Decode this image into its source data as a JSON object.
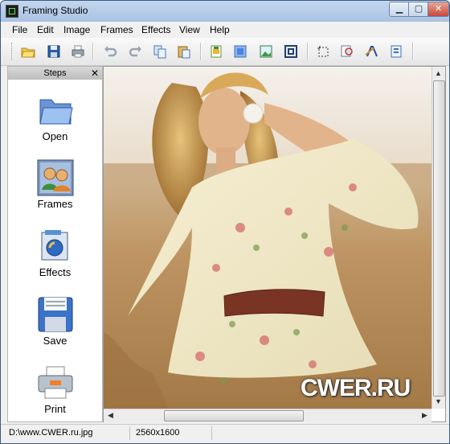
{
  "window": {
    "title": "Framing Studio"
  },
  "menu": [
    "File",
    "Edit",
    "Image",
    "Frames",
    "Effects",
    "View",
    "Help"
  ],
  "toolbar": {
    "buttons": [
      "open-icon",
      "save-icon",
      "print-icon",
      "undo-icon",
      "redo-icon",
      "copy-icon",
      "paste-icon",
      "crop-icon",
      "frame-icon",
      "image-icon",
      "border-icon",
      "select-icon",
      "zoom-icon",
      "text-icon",
      "info-icon"
    ]
  },
  "steps": {
    "title": "Steps",
    "close": "✕",
    "items": [
      {
        "label": "Open",
        "icon": "folder-icon"
      },
      {
        "label": "Frames",
        "icon": "frames-icon"
      },
      {
        "label": "Effects",
        "icon": "effects-icon"
      },
      {
        "label": "Save",
        "icon": "floppy-icon"
      },
      {
        "label": "Print",
        "icon": "printer-icon"
      }
    ]
  },
  "viewer": {
    "watermark": "CWER.RU"
  },
  "status": {
    "path": "D:\\www.CWER.ru.jpg",
    "dimensions": "2560x1600"
  },
  "colors": {
    "accent": "#c5d7ee",
    "close": "#c7473a"
  }
}
